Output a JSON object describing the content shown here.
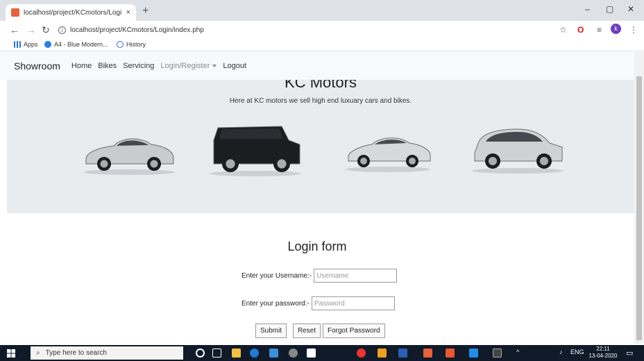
{
  "browser": {
    "tab_title": "localhost/project/KCmotors/Logi",
    "tab_close": "×",
    "new_tab": "+",
    "address": "localhost/project/KCmotors/Login/index.php",
    "profile_initial": "k",
    "controls": {
      "minimize": "–",
      "restore": "▢",
      "close": "✕"
    }
  },
  "bookmarks": [
    {
      "label": "Apps"
    },
    {
      "label": "A4 - Blue Modern..."
    },
    {
      "label": "History"
    }
  ],
  "navbar": {
    "brand": "Showroom",
    "links": [
      "Home",
      "Bikes",
      "Servicing",
      "Login/Register",
      "Logout"
    ]
  },
  "hero": {
    "title": "KC Motors",
    "subtitle": "Here at KC motors we sell high end luxuary cars and bikes.",
    "car_colors": [
      "#c9cbcd",
      "#1b1d20",
      "#d7d9db",
      "#cfd1d3"
    ]
  },
  "login": {
    "title": "Login form",
    "username_label": "Enter your Username:-",
    "username_placeholder": "Username",
    "password_label": "Enter your password:-",
    "password_placeholder": "Password",
    "submit": "Submit",
    "reset": "Reset",
    "forgot": "Forgot Password"
  },
  "taskbar": {
    "search_placeholder": "Type here to search",
    "tray_lang": "ENG",
    "time": "22:11",
    "date": "13-04-2020"
  }
}
